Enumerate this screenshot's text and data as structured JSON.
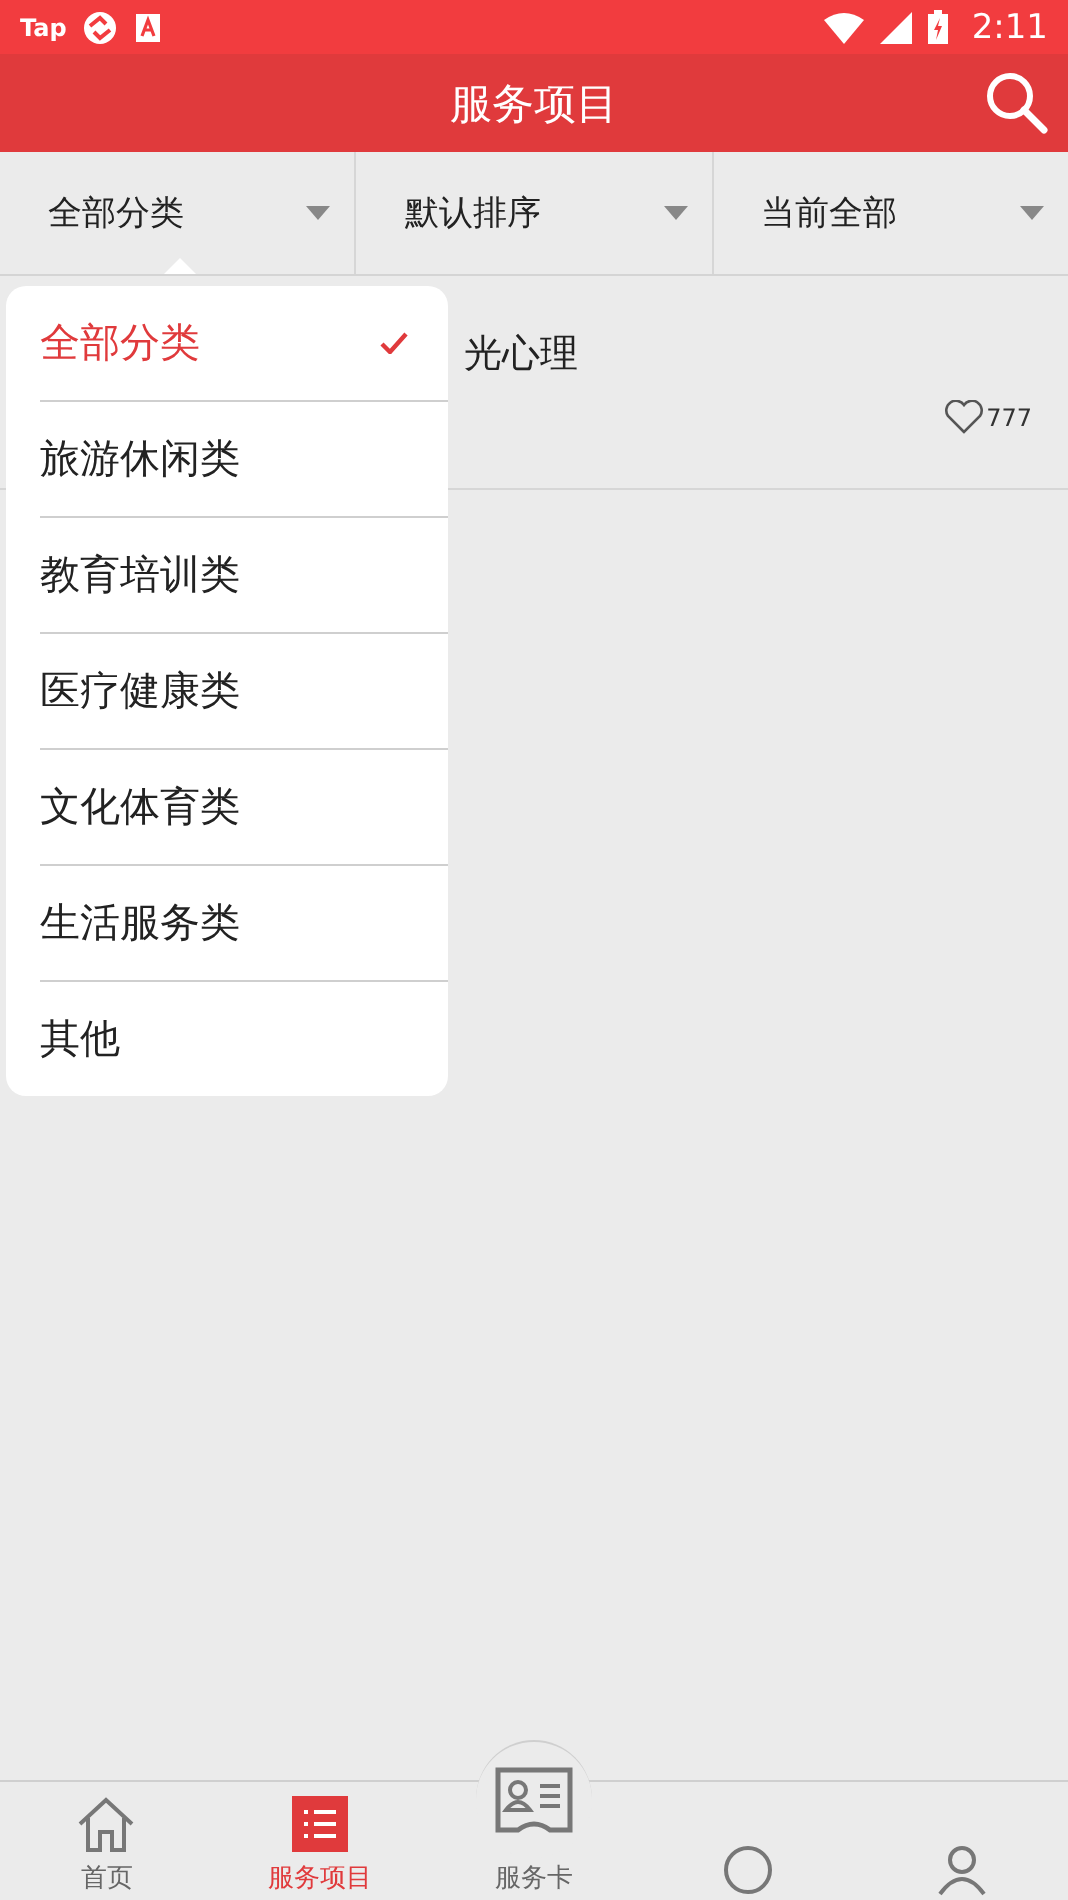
{
  "status_bar": {
    "app_label": "Tap",
    "time": "2:11"
  },
  "header": {
    "title": "服务项目"
  },
  "filters": [
    {
      "label": "全部分类",
      "selected": true
    },
    {
      "label": "默认排序",
      "selected": false
    },
    {
      "label": "当前全部",
      "selected": false
    }
  ],
  "list": [
    {
      "title": "光心理",
      "likes": "777"
    }
  ],
  "dropdown": {
    "items": [
      {
        "label": "全部分类",
        "selected": true
      },
      {
        "label": "旅游休闲类",
        "selected": false
      },
      {
        "label": "教育培训类",
        "selected": false
      },
      {
        "label": "医疗健康类",
        "selected": false
      },
      {
        "label": "文化体育类",
        "selected": false
      },
      {
        "label": "生活服务类",
        "selected": false
      },
      {
        "label": "其他",
        "selected": false
      }
    ]
  },
  "bottom_nav": [
    {
      "kind": "home",
      "label": "首页",
      "selected": false
    },
    {
      "kind": "list",
      "label": "服务项目",
      "selected": true
    },
    {
      "kind": "card",
      "label": "服务卡",
      "selected": false
    },
    {
      "kind": "hidden4",
      "selected": false
    },
    {
      "kind": "hidden5",
      "selected": false
    }
  ]
}
